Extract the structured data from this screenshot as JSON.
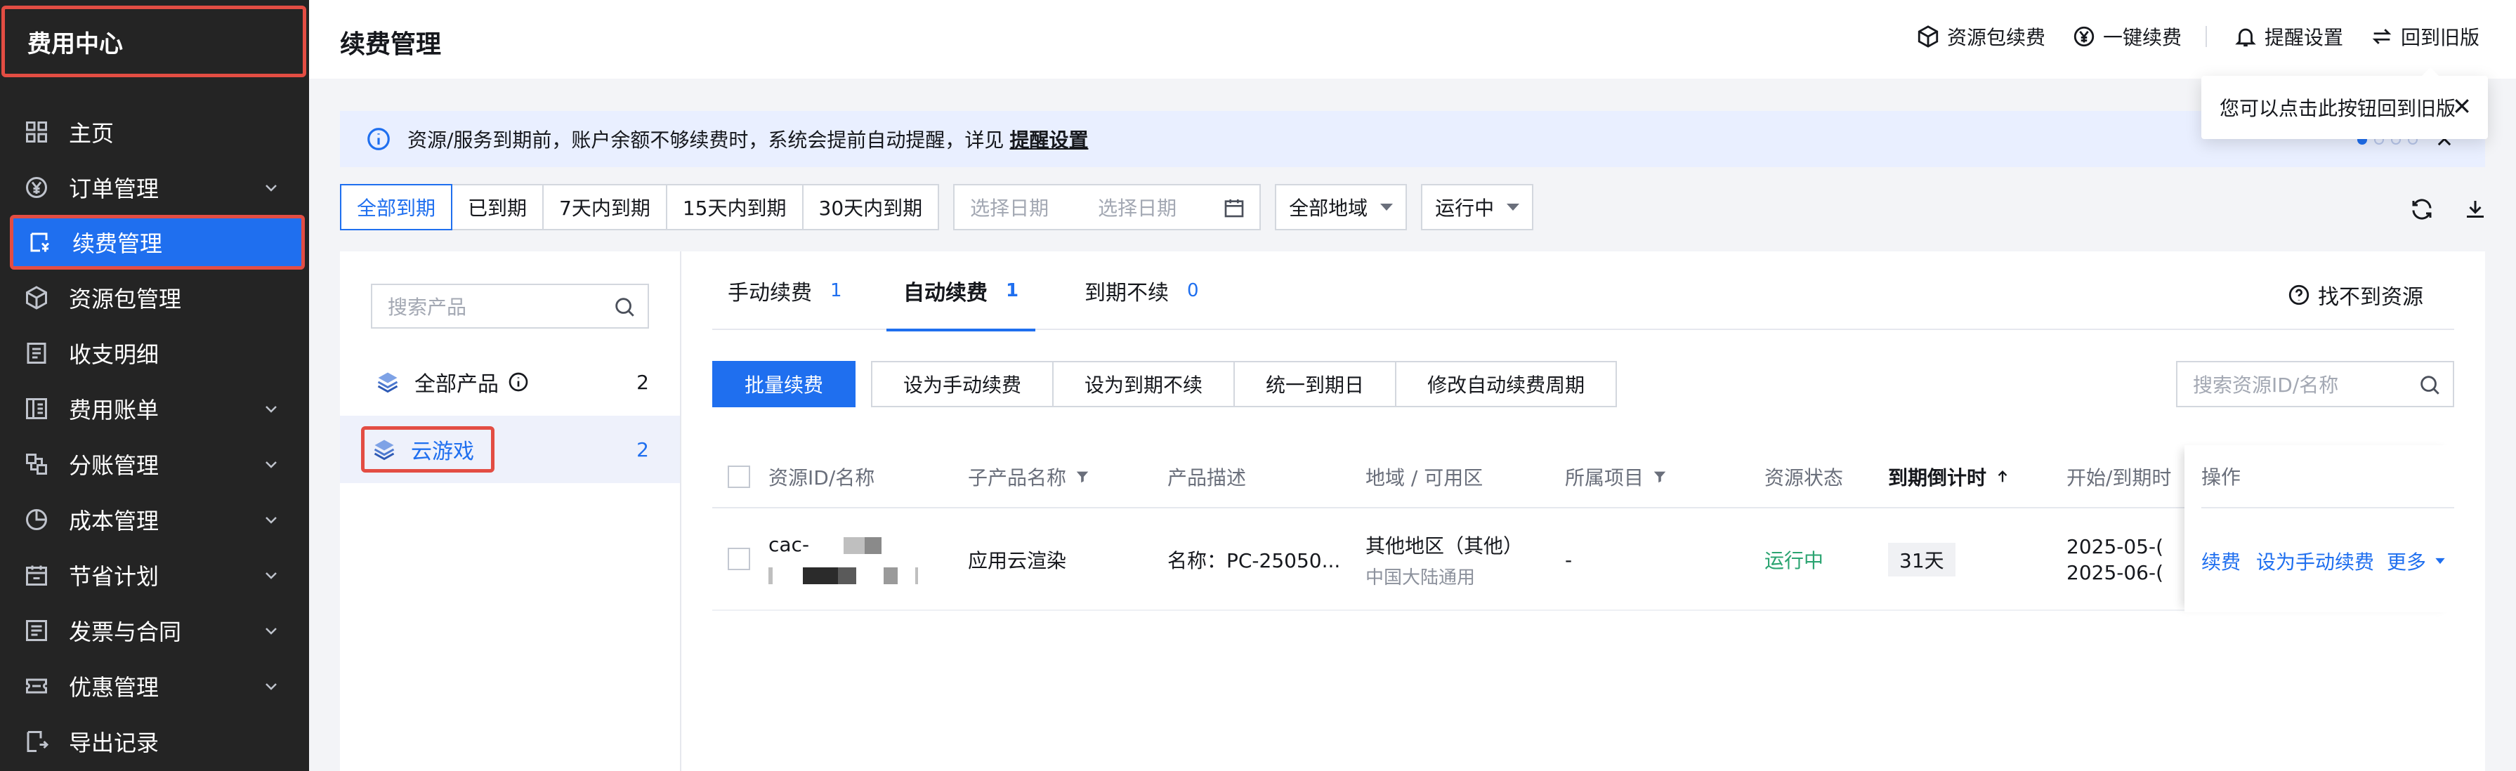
{
  "sidebar": {
    "title": "费用中心",
    "items": [
      {
        "label": "主页",
        "icon": "grid-icon",
        "expandable": false
      },
      {
        "label": "订单管理",
        "icon": "yen-circle-icon",
        "expandable": true
      },
      {
        "label": "续费管理",
        "icon": "renew-card-icon",
        "expandable": false,
        "active": true
      },
      {
        "label": "资源包管理",
        "icon": "cube-icon",
        "expandable": false
      },
      {
        "label": "收支明细",
        "icon": "ledger-icon",
        "expandable": false
      },
      {
        "label": "费用账单",
        "icon": "bill-icon",
        "expandable": true
      },
      {
        "label": "分账管理",
        "icon": "split-icon",
        "expandable": true
      },
      {
        "label": "成本管理",
        "icon": "pie-icon",
        "expandable": true
      },
      {
        "label": "节省计划",
        "icon": "calendar-icon",
        "expandable": true
      },
      {
        "label": "发票与合同",
        "icon": "invoice-icon",
        "expandable": true
      },
      {
        "label": "优惠管理",
        "icon": "ticket-icon",
        "expandable": true
      },
      {
        "label": "导出记录",
        "icon": "export-icon",
        "expandable": false
      }
    ]
  },
  "header": {
    "title": "续费管理",
    "actions": [
      {
        "label": "资源包续费",
        "icon": "cube-icon"
      },
      {
        "label": "一键续费",
        "icon": "yen-circle-icon"
      },
      {
        "label": "提醒设置",
        "icon": "bell-icon"
      },
      {
        "label": "回到旧版",
        "icon": "switch-icon"
      }
    ]
  },
  "tooltip": {
    "text": "您可以点击此按钮回到旧版"
  },
  "notice": {
    "text": "资源/服务到期前，账户余额不够续费时，系统会提前自动提醒，详见",
    "link": "提醒设置"
  },
  "filters": {
    "segments": [
      "全部到期",
      "已到期",
      "7天内到期",
      "15天内到期",
      "30天内到期"
    ],
    "active_segment": "全部到期",
    "date_start_placeholder": "选择日期",
    "date_end_placeholder": "选择日期",
    "region": "全部地域",
    "status": "运行中"
  },
  "products": {
    "search_placeholder": "搜索产品",
    "items": [
      {
        "label": "全部产品",
        "count": "2"
      },
      {
        "label": "云游戏",
        "count": "2"
      }
    ]
  },
  "tabs": [
    {
      "label": "手动续费",
      "count": "1"
    },
    {
      "label": "自动续费",
      "count": "1"
    },
    {
      "label": "到期不续",
      "count": "0"
    }
  ],
  "help_link": "找不到资源",
  "buttons": {
    "batch": "批量续费",
    "actions": [
      "设为手动续费",
      "设为到期不续",
      "统一到期日",
      "修改自动续费周期"
    ]
  },
  "resource_search_placeholder": "搜索资源ID/名称",
  "table": {
    "columns": [
      "资源ID/名称",
      "子产品名称",
      "产品描述",
      "地域 / 可用区",
      "所属项目",
      "资源状态",
      "到期倒计时",
      "开始/到期时",
      "操作"
    ],
    "rows": [
      {
        "id_prefix": "cac-",
        "sub_product": "应用云渲染",
        "description": "名称：PC-25050...",
        "region": "其他地区（其他）",
        "zone": "中国大陆通用",
        "project": "-",
        "status": "运行中",
        "countdown": "31天",
        "start": "2025-05-(",
        "end": "2025-06-(",
        "op_renew": "续费",
        "op_manual": "设为手动续费",
        "op_more": "更多"
      }
    ]
  },
  "colors": {
    "accent": "#1f6fef",
    "sidebar_bg": "#242424",
    "highlight_border": "#e34d43",
    "status_green": "#2ba471"
  }
}
